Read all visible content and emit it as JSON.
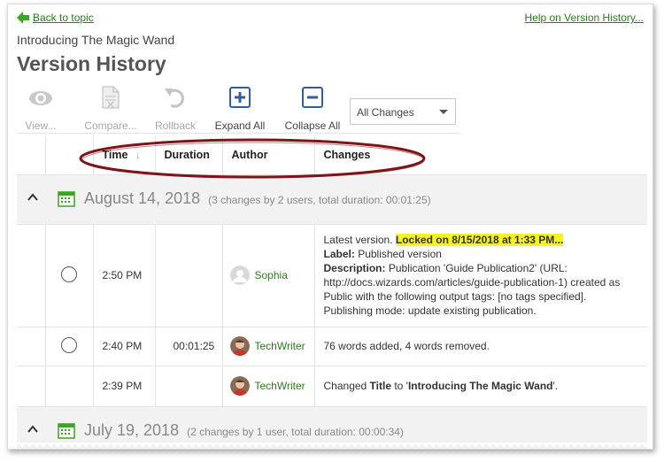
{
  "nav": {
    "back_label": "Back to topic",
    "help_label": "Help on Version History..."
  },
  "header": {
    "subtitle": "Introducing The Magic Wand",
    "title": "Version History"
  },
  "toolbar": {
    "view_label": "View...",
    "compare_label": "Compare...",
    "rollback_label": "Rollback",
    "expand_label": "Expand All",
    "collapse_label": "Collapse All",
    "filter_value": "All Changes"
  },
  "table": {
    "columns": {
      "time": "Time",
      "sort_indicator": "↓",
      "duration": "Duration",
      "author": "Author",
      "changes": "Changes"
    },
    "groups": [
      {
        "date": "August 14, 2018",
        "meta": "(3 changes by 2 users, total duration: 00:01:25)",
        "rows": [
          {
            "time": "2:50 PM",
            "duration": "",
            "author": "Sophia",
            "latest": "Latest version.",
            "locked": "Locked on 8/15/2018 at 1:33 PM...",
            "label_key": "Label:",
            "label_value": "Published version",
            "desc_key": "Description:",
            "desc_value": "Publication 'Guide Publication2' (URL: http://docs.wizards.com/articles/guide-publication-1) created as Public with the following output tags: [no tags specified]. Publishing mode: update existing publication."
          },
          {
            "time": "2:40 PM",
            "duration": "00:01:25",
            "author": "TechWriter",
            "change": "76 words added, 4 words removed."
          },
          {
            "time": "2:39 PM",
            "duration": "",
            "author": "TechWriter",
            "change_prefix": "Changed ",
            "change_field": "Title",
            "change_mid": " to '",
            "change_value": "Introducing The Magic Wand",
            "change_suffix": "'."
          }
        ]
      },
      {
        "date": "July 19, 2018",
        "meta": "(2 changes by 1 user, total duration: 00:00:34)"
      }
    ]
  },
  "colors": {
    "link_green": "#2a7a1c",
    "highlight_yellow": "#f7f221",
    "annotation_red": "#7e1416"
  }
}
